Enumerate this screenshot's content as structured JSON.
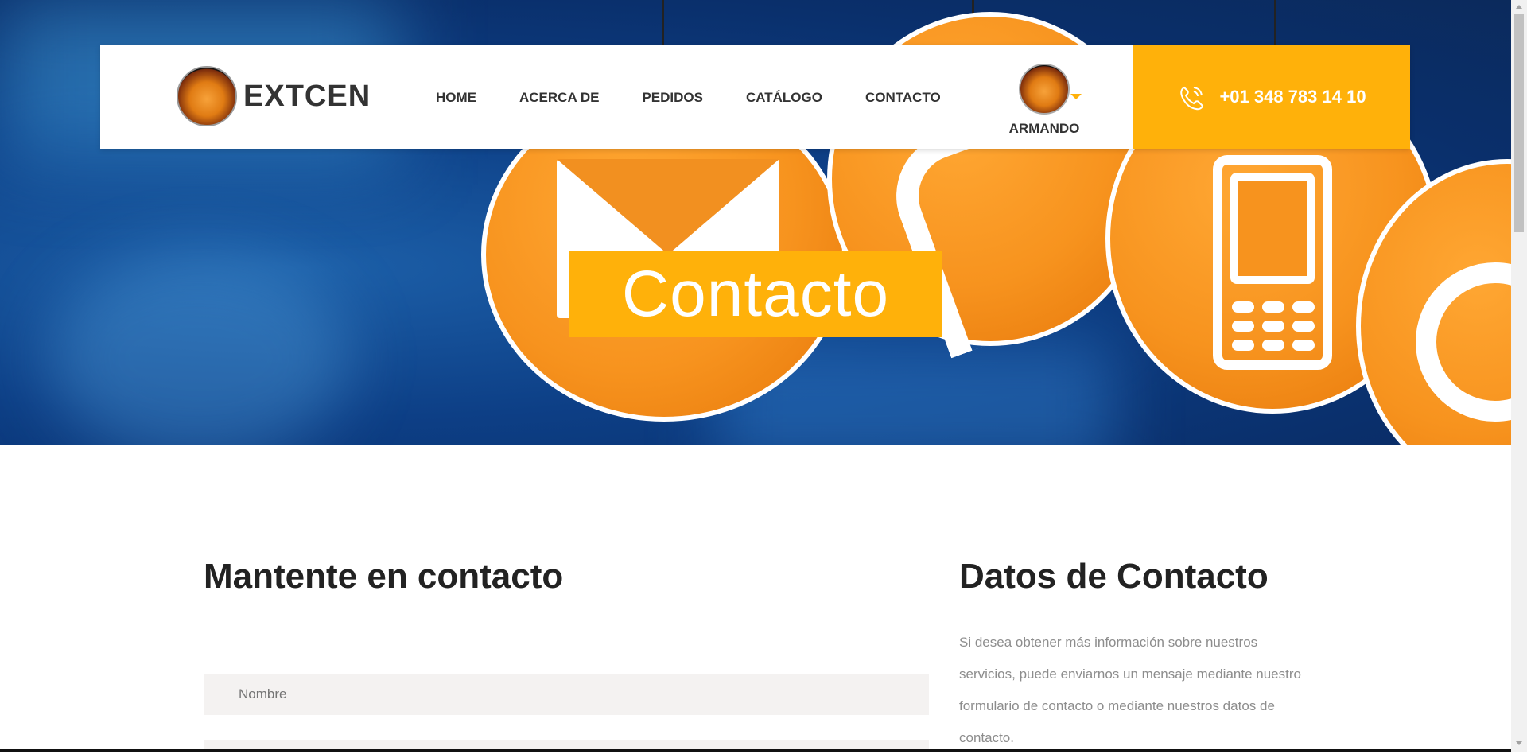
{
  "header": {
    "brand": "EXTCEN",
    "nav": [
      "HOME",
      "ACERCA DE",
      "PEDIDOS",
      "CATÁLOGO",
      "CONTACTO"
    ],
    "user_name": "ARMANDO",
    "phone": "+01 348 783 14 10"
  },
  "hero": {
    "title": "Contacto"
  },
  "content": {
    "left_heading": "Mantente en contacto",
    "right_heading": "Datos de Contacto",
    "name_placeholder": "Nombre",
    "info_text": "Si desea obtener más información sobre nuestros servicios, puede enviarnos un mensaje mediante nuestro formulario de contacto o mediante nuestros datos de contacto."
  },
  "colors": {
    "accent": "#ffb10a",
    "hero_blue": "#0d3f86",
    "disc_orange": "#f7931e"
  },
  "icons": {
    "phone": "phone-icon",
    "caret": "chevron-down-icon"
  }
}
